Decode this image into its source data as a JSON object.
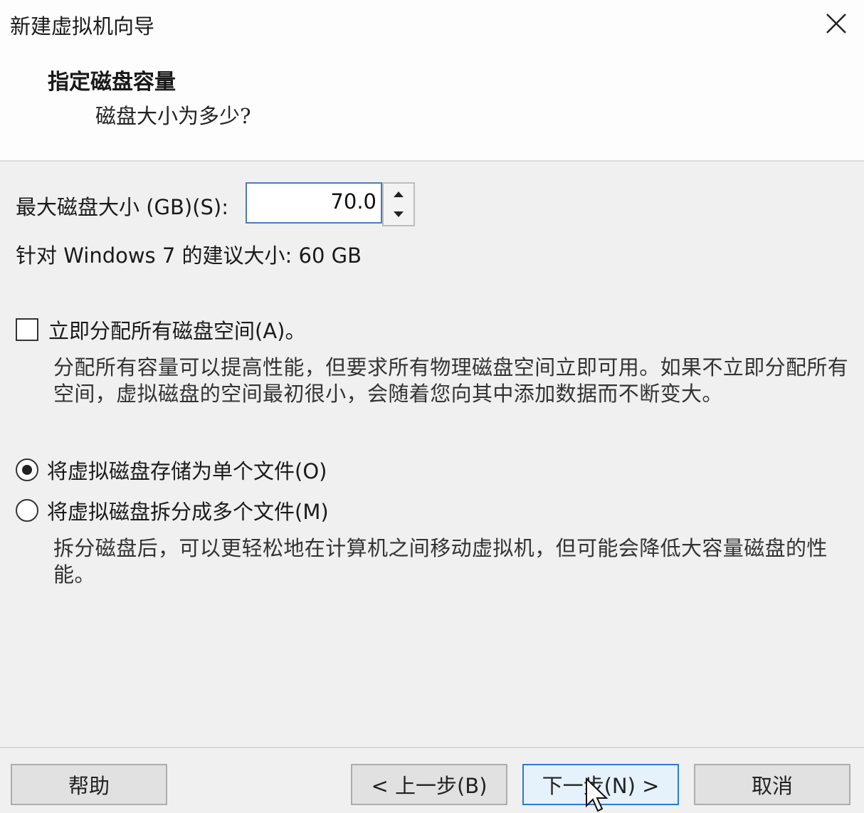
{
  "window": {
    "title": "新建虚拟机向导"
  },
  "header": {
    "heading": "指定磁盘容量",
    "subheading": "磁盘大小为多少?"
  },
  "disk_size": {
    "label": "最大磁盘大小 (GB)(S):",
    "value": "70.0",
    "recommendation": "针对 Windows 7 的建议大小: 60 GB"
  },
  "allocate": {
    "label": "立即分配所有磁盘空间(A)。",
    "checked": false,
    "description": "分配所有容量可以提高性能，但要求所有物理磁盘空间立即可用。如果不立即分配所有空间，虚拟磁盘的空间最初很小，会随着您向其中添加数据而不断变大。"
  },
  "storage": {
    "single_label": "将虚拟磁盘存储为单个文件(O)",
    "multiple_label": "将虚拟磁盘拆分成多个文件(M)",
    "selected": "single",
    "description": "拆分磁盘后，可以更轻松地在计算机之间移动虚拟机，但可能会降低大容量磁盘的性能。"
  },
  "buttons": {
    "help": "帮助",
    "back": "< 上一步(B)",
    "next": "下一步(N) >",
    "cancel": "取消"
  },
  "icons": {
    "close": "close-icon",
    "spin_up": "chevron-up-icon",
    "spin_down": "chevron-down-icon",
    "cursor": "mouse-pointer-icon"
  },
  "colors": {
    "accent_border": "#2b7bd8",
    "input_border": "#4a7bc5",
    "header_bg": "#fdfdfd",
    "body_bg": "#f0f0f0"
  }
}
